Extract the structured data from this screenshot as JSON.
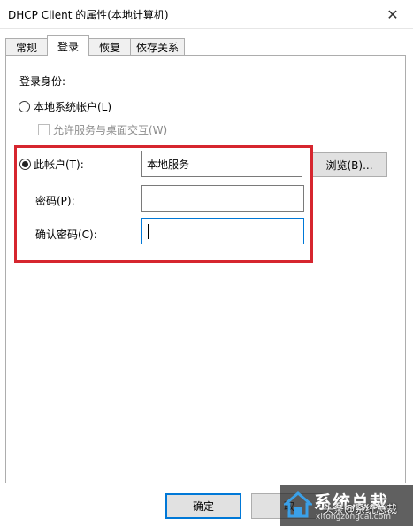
{
  "window": {
    "title": "DHCP Client 的属性(本地计算机)",
    "close_glyph": "✕"
  },
  "tabs": [
    {
      "label": "常规"
    },
    {
      "label": "登录"
    },
    {
      "label": "恢复"
    },
    {
      "label": "依存关系"
    }
  ],
  "active_tab": "登录",
  "logon": {
    "section_label": "登录身份:",
    "local_system_label": "本地系统帐户(L)",
    "local_system_checked": false,
    "desktop_interact_label": "允许服务与桌面交互(W)",
    "desktop_interact_checked": false,
    "this_account_label": "此帐户(T):",
    "this_account_checked": true,
    "account_value": "本地服务",
    "browse_label": "浏览(B)...",
    "password_label": "密码(P):",
    "password_value": "",
    "confirm_label": "确认密码(C):",
    "confirm_value": ""
  },
  "footer": {
    "ok_label": "确定",
    "cancel_label": "取"
  },
  "watermark": {
    "main": "系统总裁",
    "sub": "xitongzongcai.com",
    "overlay": "头条@系统总裁"
  },
  "colors": {
    "highlight": "#d6262f",
    "focus_border": "#0078d7"
  },
  "icons": {
    "close": "close-icon",
    "watermark_logo": "house-logo-icon"
  }
}
